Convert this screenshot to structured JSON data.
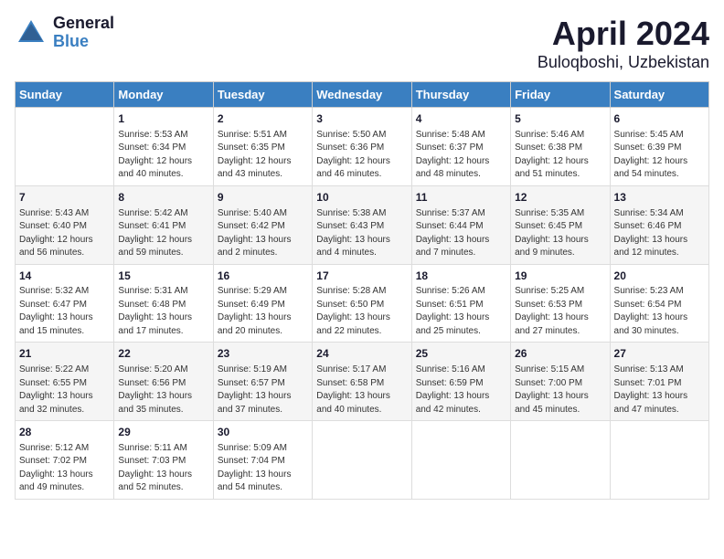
{
  "header": {
    "logo_general": "General",
    "logo_blue": "Blue",
    "title": "April 2024",
    "subtitle": "Buloqboshi, Uzbekistan"
  },
  "days_of_week": [
    "Sunday",
    "Monday",
    "Tuesday",
    "Wednesday",
    "Thursday",
    "Friday",
    "Saturday"
  ],
  "weeks": [
    [
      {
        "day": "",
        "info": ""
      },
      {
        "day": "1",
        "info": "Sunrise: 5:53 AM\nSunset: 6:34 PM\nDaylight: 12 hours\nand 40 minutes."
      },
      {
        "day": "2",
        "info": "Sunrise: 5:51 AM\nSunset: 6:35 PM\nDaylight: 12 hours\nand 43 minutes."
      },
      {
        "day": "3",
        "info": "Sunrise: 5:50 AM\nSunset: 6:36 PM\nDaylight: 12 hours\nand 46 minutes."
      },
      {
        "day": "4",
        "info": "Sunrise: 5:48 AM\nSunset: 6:37 PM\nDaylight: 12 hours\nand 48 minutes."
      },
      {
        "day": "5",
        "info": "Sunrise: 5:46 AM\nSunset: 6:38 PM\nDaylight: 12 hours\nand 51 minutes."
      },
      {
        "day": "6",
        "info": "Sunrise: 5:45 AM\nSunset: 6:39 PM\nDaylight: 12 hours\nand 54 minutes."
      }
    ],
    [
      {
        "day": "7",
        "info": "Sunrise: 5:43 AM\nSunset: 6:40 PM\nDaylight: 12 hours\nand 56 minutes."
      },
      {
        "day": "8",
        "info": "Sunrise: 5:42 AM\nSunset: 6:41 PM\nDaylight: 12 hours\nand 59 minutes."
      },
      {
        "day": "9",
        "info": "Sunrise: 5:40 AM\nSunset: 6:42 PM\nDaylight: 13 hours\nand 2 minutes."
      },
      {
        "day": "10",
        "info": "Sunrise: 5:38 AM\nSunset: 6:43 PM\nDaylight: 13 hours\nand 4 minutes."
      },
      {
        "day": "11",
        "info": "Sunrise: 5:37 AM\nSunset: 6:44 PM\nDaylight: 13 hours\nand 7 minutes."
      },
      {
        "day": "12",
        "info": "Sunrise: 5:35 AM\nSunset: 6:45 PM\nDaylight: 13 hours\nand 9 minutes."
      },
      {
        "day": "13",
        "info": "Sunrise: 5:34 AM\nSunset: 6:46 PM\nDaylight: 13 hours\nand 12 minutes."
      }
    ],
    [
      {
        "day": "14",
        "info": "Sunrise: 5:32 AM\nSunset: 6:47 PM\nDaylight: 13 hours\nand 15 minutes."
      },
      {
        "day": "15",
        "info": "Sunrise: 5:31 AM\nSunset: 6:48 PM\nDaylight: 13 hours\nand 17 minutes."
      },
      {
        "day": "16",
        "info": "Sunrise: 5:29 AM\nSunset: 6:49 PM\nDaylight: 13 hours\nand 20 minutes."
      },
      {
        "day": "17",
        "info": "Sunrise: 5:28 AM\nSunset: 6:50 PM\nDaylight: 13 hours\nand 22 minutes."
      },
      {
        "day": "18",
        "info": "Sunrise: 5:26 AM\nSunset: 6:51 PM\nDaylight: 13 hours\nand 25 minutes."
      },
      {
        "day": "19",
        "info": "Sunrise: 5:25 AM\nSunset: 6:53 PM\nDaylight: 13 hours\nand 27 minutes."
      },
      {
        "day": "20",
        "info": "Sunrise: 5:23 AM\nSunset: 6:54 PM\nDaylight: 13 hours\nand 30 minutes."
      }
    ],
    [
      {
        "day": "21",
        "info": "Sunrise: 5:22 AM\nSunset: 6:55 PM\nDaylight: 13 hours\nand 32 minutes."
      },
      {
        "day": "22",
        "info": "Sunrise: 5:20 AM\nSunset: 6:56 PM\nDaylight: 13 hours\nand 35 minutes."
      },
      {
        "day": "23",
        "info": "Sunrise: 5:19 AM\nSunset: 6:57 PM\nDaylight: 13 hours\nand 37 minutes."
      },
      {
        "day": "24",
        "info": "Sunrise: 5:17 AM\nSunset: 6:58 PM\nDaylight: 13 hours\nand 40 minutes."
      },
      {
        "day": "25",
        "info": "Sunrise: 5:16 AM\nSunset: 6:59 PM\nDaylight: 13 hours\nand 42 minutes."
      },
      {
        "day": "26",
        "info": "Sunrise: 5:15 AM\nSunset: 7:00 PM\nDaylight: 13 hours\nand 45 minutes."
      },
      {
        "day": "27",
        "info": "Sunrise: 5:13 AM\nSunset: 7:01 PM\nDaylight: 13 hours\nand 47 minutes."
      }
    ],
    [
      {
        "day": "28",
        "info": "Sunrise: 5:12 AM\nSunset: 7:02 PM\nDaylight: 13 hours\nand 49 minutes."
      },
      {
        "day": "29",
        "info": "Sunrise: 5:11 AM\nSunset: 7:03 PM\nDaylight: 13 hours\nand 52 minutes."
      },
      {
        "day": "30",
        "info": "Sunrise: 5:09 AM\nSunset: 7:04 PM\nDaylight: 13 hours\nand 54 minutes."
      },
      {
        "day": "",
        "info": ""
      },
      {
        "day": "",
        "info": ""
      },
      {
        "day": "",
        "info": ""
      },
      {
        "day": "",
        "info": ""
      }
    ]
  ]
}
